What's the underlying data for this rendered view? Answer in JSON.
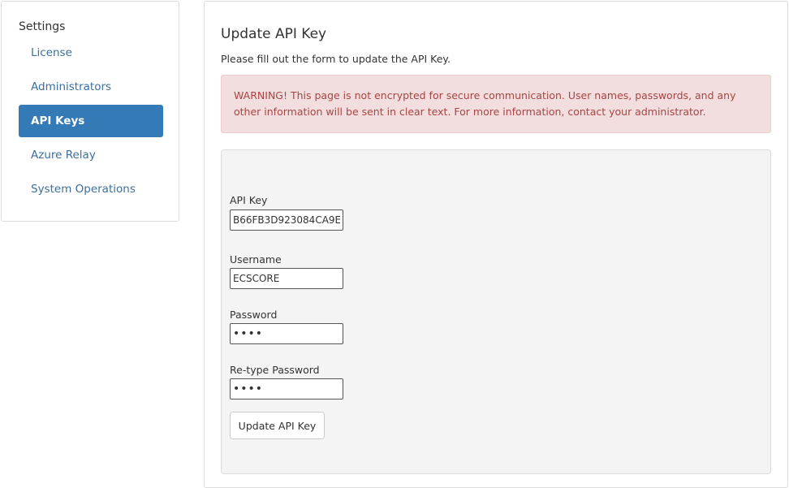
{
  "sidebar": {
    "heading": "Settings",
    "items": [
      {
        "label": "License",
        "active": false
      },
      {
        "label": "Administrators",
        "active": false
      },
      {
        "label": "API Keys",
        "active": true
      },
      {
        "label": "Azure Relay",
        "active": false
      },
      {
        "label": "System Operations",
        "active": false
      }
    ]
  },
  "main": {
    "title": "Update API Key",
    "description": "Please fill out the form to update the API Key.",
    "warning": "WARNING! This page is not encrypted for secure communication. User names, passwords, and any other information will be sent in clear text. For more information, contact your administrator.",
    "form": {
      "api_key_label": "API Key",
      "api_key_value": "B66FB3D923084CA9E",
      "username_label": "Username",
      "username_value": "ECSCORE",
      "password_label": "Password",
      "password_value": "••••",
      "retype_label": "Re-type Password",
      "retype_value": "••••",
      "submit_label": "Update API Key"
    }
  },
  "colors": {
    "accent": "#337ab7",
    "link": "#3a6f9e",
    "warning_bg": "#f2dede",
    "warning_text": "#a94442",
    "panel_bg": "#f4f4f4"
  }
}
